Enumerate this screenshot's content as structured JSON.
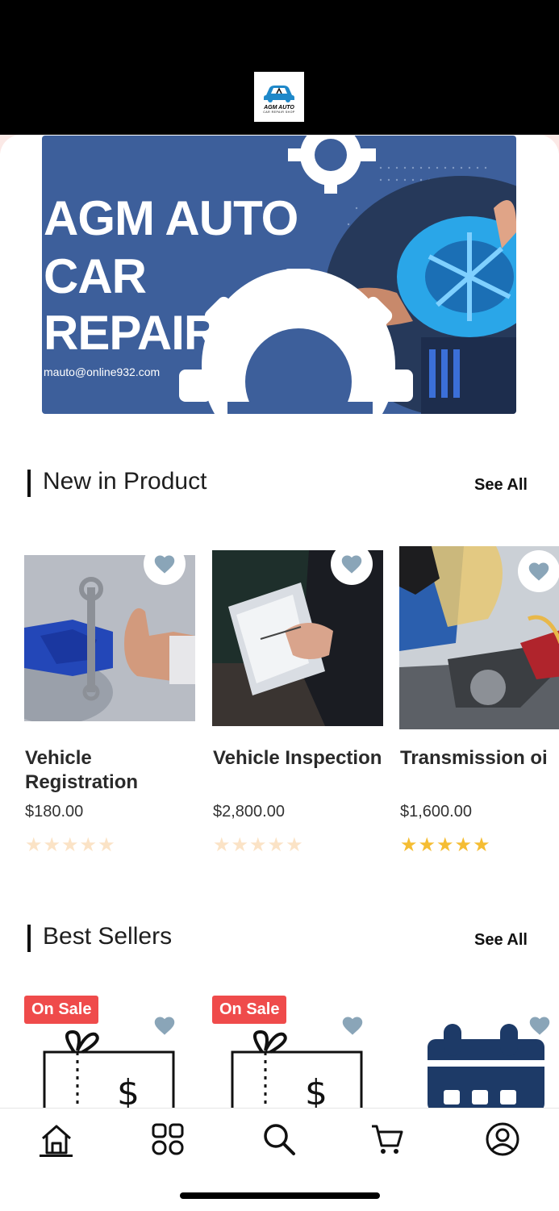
{
  "logo": {
    "title": "AGM AUTO",
    "subtitle": "CAR REPAIR SHOP"
  },
  "banner": {
    "line1": "AGM AUTO",
    "line2": "CAR",
    "line3": "REPAIR",
    "email": "mauto@online932.com"
  },
  "sections": {
    "new": {
      "title": "New in Product",
      "see_all": "See All"
    },
    "best": {
      "title": "Best Sellers",
      "see_all": "See All"
    }
  },
  "new_products": [
    {
      "name": "Vehicle Registration",
      "price": "$180.00",
      "stars": "★★★★★",
      "rating": 0
    },
    {
      "name": "Vehicle Inspection",
      "price": "$2,800.00",
      "stars": "★★★★★",
      "rating": 0
    },
    {
      "name": "Transmission oi",
      "price": "$1,600.00",
      "stars": "★★★★★",
      "rating": 5
    }
  ],
  "best_sellers": [
    {
      "badge": "On Sale"
    },
    {
      "badge": "On Sale"
    },
    {
      "badge": ""
    }
  ],
  "tabs": [
    "home-icon",
    "categories-icon",
    "search-icon",
    "cart-icon",
    "profile-icon"
  ],
  "colors": {
    "banner": "#3d5f9b",
    "sale": "#ef4b4b",
    "star_on": "#f5bd33",
    "star_off": "#fbe3c6",
    "heart": "#8aa5b8",
    "navy": "#1d3a67"
  }
}
